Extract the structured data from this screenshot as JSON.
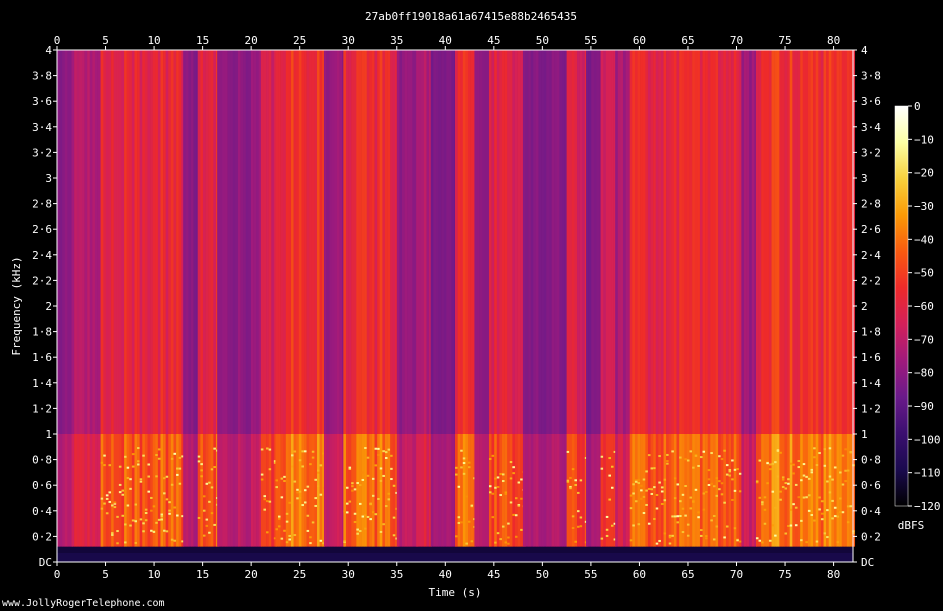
{
  "footer": "www.JollyRogerTelephone.com",
  "chart_data": {
    "type": "heatmap",
    "title": "27ab0ff19018a61a67415e88b2465435",
    "xlabel": "Time (s)",
    "ylabel": "Frequency (kHz)",
    "xlim": [
      0,
      82
    ],
    "ylim": [
      0,
      4
    ],
    "x_ticks": [
      0,
      5,
      10,
      15,
      20,
      25,
      30,
      35,
      40,
      45,
      50,
      55,
      60,
      65,
      70,
      75,
      80
    ],
    "y_ticks": [
      "DC",
      "0·2",
      "0·4",
      "0·6",
      "0·8",
      "1",
      "1·2",
      "1·4",
      "1·6",
      "1·8",
      "2",
      "2·2",
      "2·4",
      "2·6",
      "2·8",
      "3",
      "3·2",
      "3·4",
      "3·6",
      "3·8",
      "4"
    ],
    "y_tick_values": [
      0,
      0.2,
      0.4,
      0.6,
      0.8,
      1,
      1.2,
      1.4,
      1.6,
      1.8,
      2,
      2.2,
      2.4,
      2.6,
      2.8,
      3,
      3.2,
      3.4,
      3.6,
      3.8,
      4
    ],
    "colorbar": {
      "label": "dBFS",
      "ticks": [
        "0",
        "−10",
        "−20",
        "−30",
        "−40",
        "−50",
        "−60",
        "−70",
        "−80",
        "−90",
        "−100",
        "−110",
        "−120"
      ],
      "tick_values": [
        0,
        -10,
        -20,
        -30,
        -40,
        -50,
        -60,
        -70,
        -80,
        -90,
        -100,
        -110,
        -120
      ],
      "range": [
        -120,
        0
      ],
      "colors": [
        "#000000",
        "#1a0a4e",
        "#3b0f70",
        "#6a1a8a",
        "#a01a7c",
        "#d3205a",
        "#ee2a2a",
        "#f85a10",
        "#fb9a06",
        "#f7d13d",
        "#fcffa4",
        "#ffffff"
      ]
    },
    "activity_segments": [
      {
        "start": 0.0,
        "end": 1.5,
        "level": 0.35
      },
      {
        "start": 1.5,
        "end": 4.5,
        "level": 0.55
      },
      {
        "start": 4.5,
        "end": 13.0,
        "level": 0.85
      },
      {
        "start": 13.0,
        "end": 14.5,
        "level": 0.35
      },
      {
        "start": 14.5,
        "end": 16.5,
        "level": 0.85
      },
      {
        "start": 16.5,
        "end": 21.0,
        "level": 0.4
      },
      {
        "start": 21.0,
        "end": 22.5,
        "level": 0.7
      },
      {
        "start": 22.5,
        "end": 27.5,
        "level": 0.95
      },
      {
        "start": 27.5,
        "end": 29.5,
        "level": 0.45
      },
      {
        "start": 29.5,
        "end": 35.0,
        "level": 0.9
      },
      {
        "start": 35.0,
        "end": 37.0,
        "level": 0.4
      },
      {
        "start": 37.0,
        "end": 38.5,
        "level": 0.55
      },
      {
        "start": 38.5,
        "end": 41.0,
        "level": 0.3
      },
      {
        "start": 41.0,
        "end": 43.0,
        "level": 0.9
      },
      {
        "start": 43.0,
        "end": 44.5,
        "level": 0.4
      },
      {
        "start": 44.5,
        "end": 48.0,
        "level": 0.8
      },
      {
        "start": 48.0,
        "end": 52.5,
        "level": 0.35
      },
      {
        "start": 52.5,
        "end": 54.5,
        "level": 0.75
      },
      {
        "start": 54.5,
        "end": 56.0,
        "level": 0.3
      },
      {
        "start": 56.0,
        "end": 57.5,
        "level": 0.7
      },
      {
        "start": 57.5,
        "end": 59.0,
        "level": 0.5
      },
      {
        "start": 59.0,
        "end": 70.5,
        "level": 0.85
      },
      {
        "start": 70.5,
        "end": 72.0,
        "level": 0.45
      },
      {
        "start": 72.0,
        "end": 82.0,
        "level": 0.95
      }
    ]
  }
}
